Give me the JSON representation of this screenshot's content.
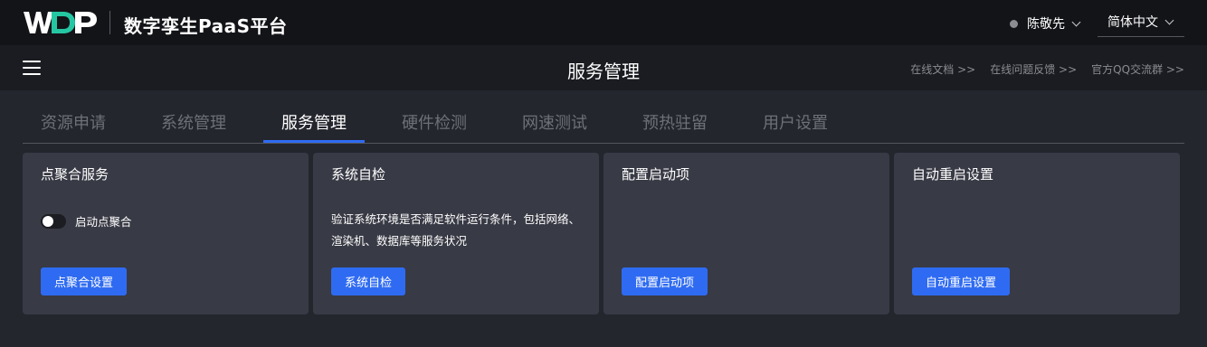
{
  "header": {
    "logo_text": "WDP",
    "app_title": "数字孪生PaaS平台",
    "user_name": "陈敬先",
    "language": "简体中文"
  },
  "subheader": {
    "title": "服务管理",
    "links": [
      "在线文档 >>",
      "在线问题反馈 >>",
      "官方QQ交流群 >>"
    ]
  },
  "tabs": [
    {
      "label": "资源申请",
      "active": false
    },
    {
      "label": "系统管理",
      "active": false
    },
    {
      "label": "服务管理",
      "active": true
    },
    {
      "label": "硬件检测",
      "active": false
    },
    {
      "label": "网速测试",
      "active": false
    },
    {
      "label": "预热驻留",
      "active": false
    },
    {
      "label": "用户设置",
      "active": false
    }
  ],
  "cards": [
    {
      "title": "点聚合服务",
      "toggle_label": "启动点聚合",
      "toggle_on": false,
      "button": "点聚合设置"
    },
    {
      "title": "系统自检",
      "description": "验证系统环境是否满足软件运行条件，包括网络、渲染机、数据库等服务状况",
      "button": "系统自检"
    },
    {
      "title": "配置启动项",
      "button": "配置启动项"
    },
    {
      "title": "自动重启设置",
      "button": "自动重启设置"
    }
  ],
  "colors": {
    "accent": "#2f6bf2",
    "background": "#24262e",
    "topbar": "#131418",
    "card": "#383a45"
  }
}
